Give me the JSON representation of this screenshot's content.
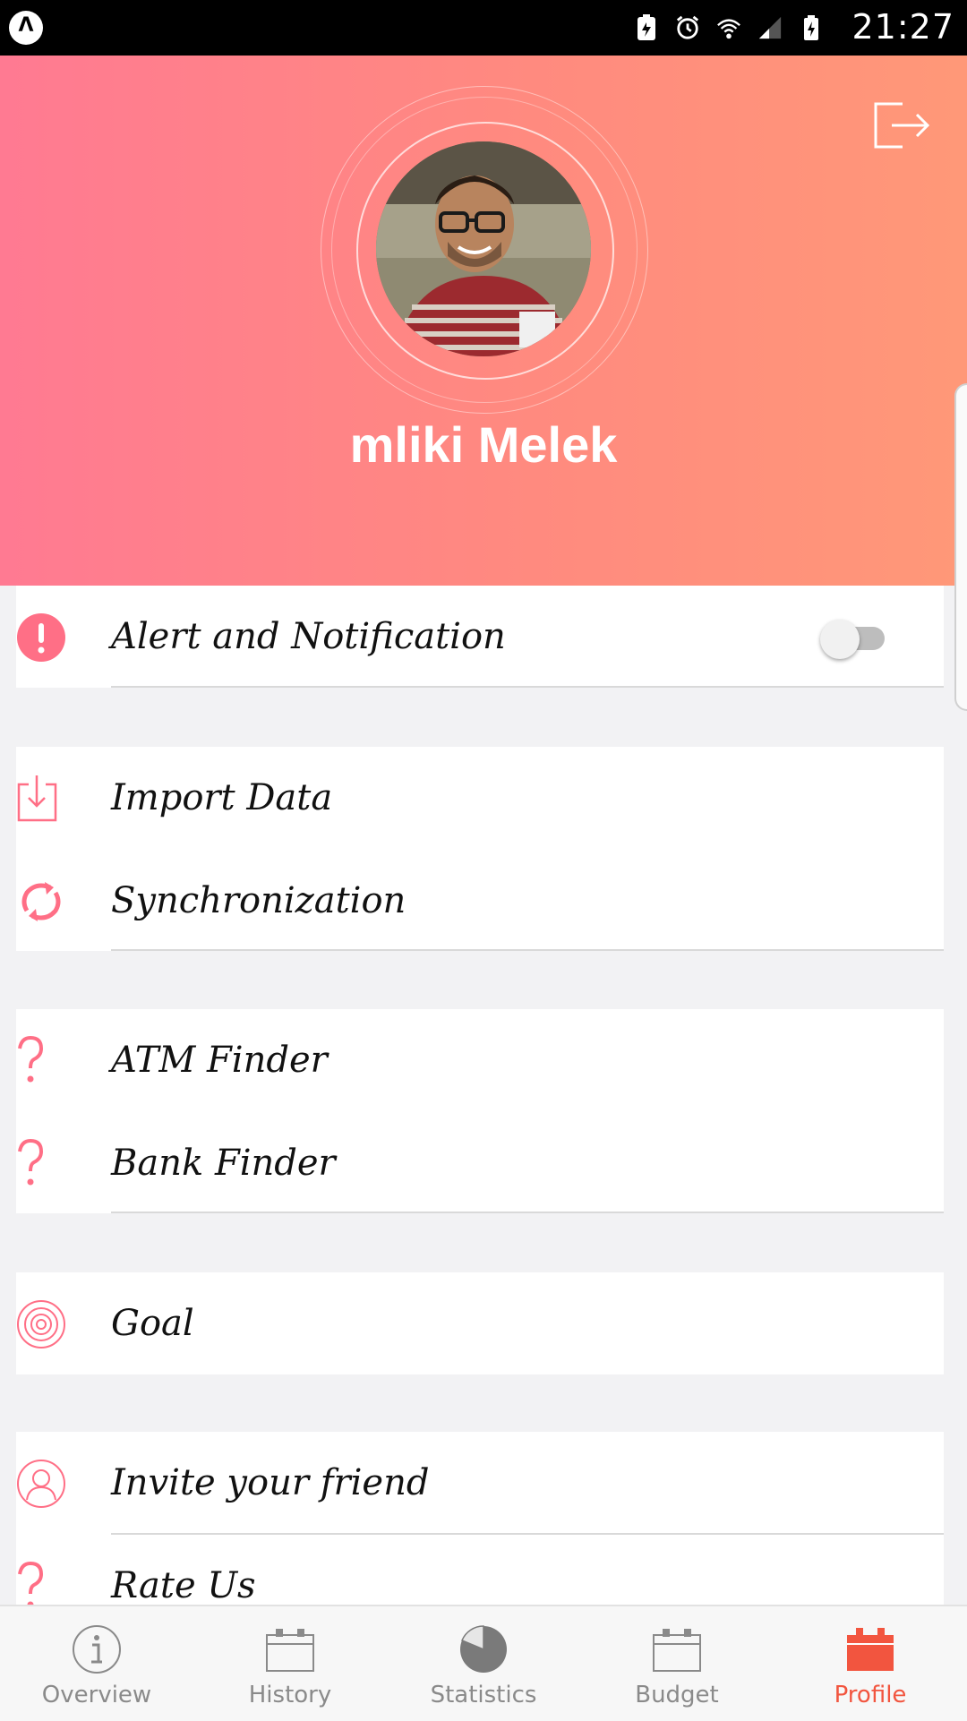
{
  "status_bar": {
    "time": "21:27"
  },
  "profile": {
    "name": "mliki Melek"
  },
  "colors": {
    "accent": "#ff6f86",
    "active_tab": "#f2553f",
    "header_start": "#ff7a92",
    "header_end": "#ff9878"
  },
  "menu": {
    "alert": {
      "label": "Alert and Notification",
      "icon": "exclamation-icon",
      "toggle_on": false
    },
    "import": {
      "label": "Import Data",
      "icon": "download-icon"
    },
    "sync": {
      "label": "Synchronization",
      "icon": "sync-icon"
    },
    "atm": {
      "label": "ATM Finder",
      "icon": "question-icon"
    },
    "bank": {
      "label": "Bank Finder",
      "icon": "question-icon"
    },
    "goal": {
      "label": "Goal",
      "icon": "target-icon"
    },
    "invite": {
      "label": "Invite your friend",
      "icon": "user-icon"
    },
    "rate": {
      "label": "Rate Us",
      "icon": "question-icon"
    }
  },
  "bottom_nav": {
    "overview": "Overview",
    "history": "History",
    "statistics": "Statistics",
    "budget": "Budget",
    "profile": "Profile",
    "active": "Profile"
  }
}
